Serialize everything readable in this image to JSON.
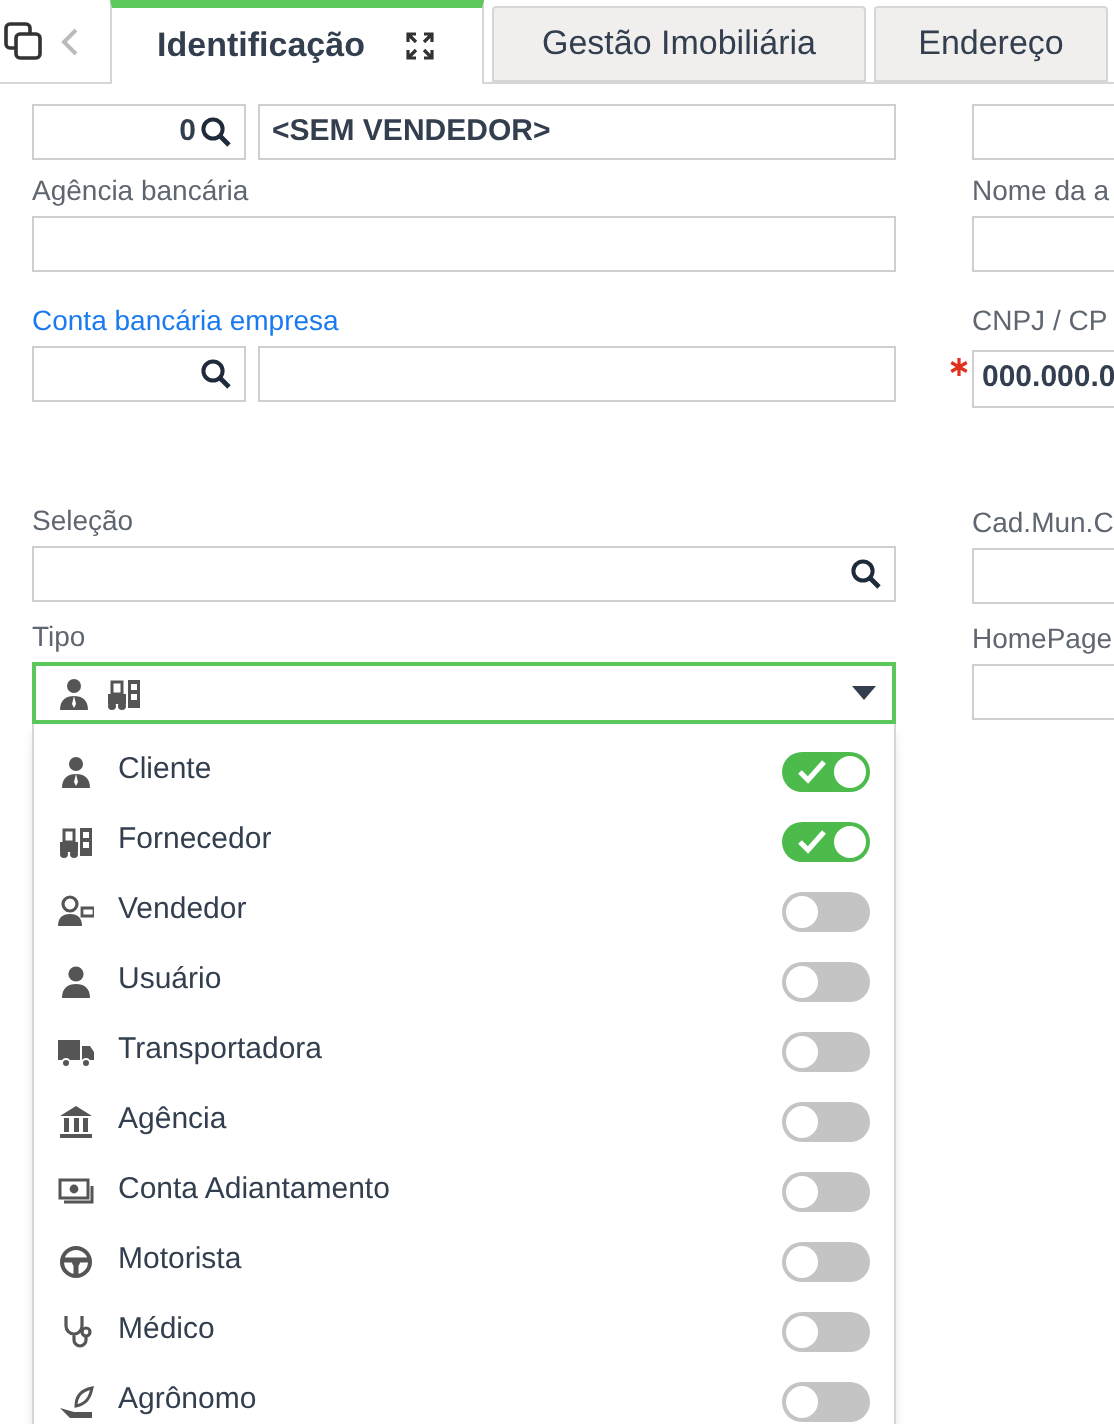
{
  "tabs": [
    {
      "label": "Identificação",
      "selected": true
    },
    {
      "label": "Gestão Imobiliária",
      "selected": false
    },
    {
      "label": "Endereço",
      "selected": false
    }
  ],
  "left_fields": [
    {
      "code": "0",
      "value": "<SEM VENDEDOR>",
      "kind": "lookup"
    },
    {
      "label": "Agência bancária",
      "link": false,
      "kind": "text"
    },
    {
      "label": "Conta bancária empresa",
      "link": true,
      "kind": "lookup"
    },
    {
      "label": "Seleção",
      "link": false,
      "kind": "search"
    }
  ],
  "tipo": {
    "label": "Tipo",
    "options": [
      {
        "label": "Cliente",
        "on": true
      },
      {
        "label": "Fornecedor",
        "on": true
      },
      {
        "label": "Vendedor",
        "on": false
      },
      {
        "label": "Usuário",
        "on": false
      },
      {
        "label": "Transportadora",
        "on": false
      },
      {
        "label": "Agência",
        "on": false
      },
      {
        "label": "Conta Adiantamento",
        "on": false
      },
      {
        "label": "Motorista",
        "on": false
      },
      {
        "label": "Médico",
        "on": false
      },
      {
        "label": "Agrônomo",
        "on": false
      }
    ]
  },
  "right_fields": [
    {
      "kind": "text"
    },
    {
      "label": "Nome da a",
      "link": false,
      "kind": "text"
    },
    {
      "label": "CNPJ / CP",
      "link": false,
      "required": true,
      "value": "000.000.0",
      "kind": "text"
    },
    {
      "label": "Cad.Mun.C",
      "link": false,
      "kind": "text"
    },
    {
      "label": "HomePage",
      "link": false,
      "kind": "text"
    }
  ]
}
